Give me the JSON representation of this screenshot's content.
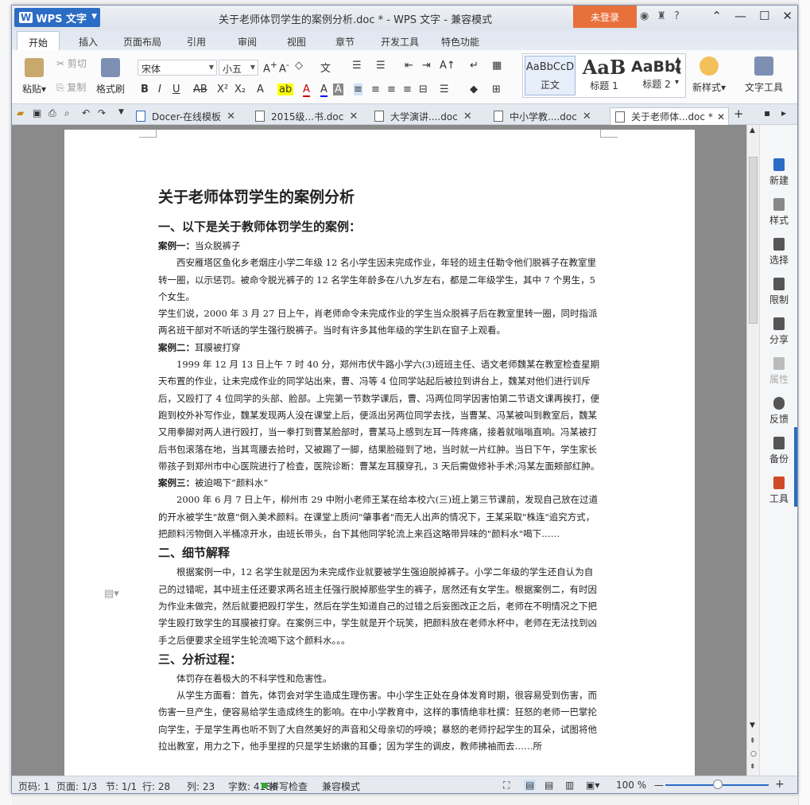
{
  "app": {
    "name": "WPS 文字",
    "window_title": "关于老师体罚学生的案例分析.doc * - WPS 文字 - 兼容模式",
    "login": "未登录"
  },
  "menu": [
    "开始",
    "插入",
    "页面布局",
    "引用",
    "审阅",
    "视图",
    "章节",
    "开发工具",
    "特色功能"
  ],
  "ribbon": {
    "paste": "粘贴",
    "cut": "剪切",
    "copy": "复制",
    "format_painter": "格式刷",
    "font_name": "宋体",
    "font_size": "小五",
    "styles": [
      {
        "preview": "AaBbCcD",
        "name": "正文"
      },
      {
        "preview": "AaB",
        "name": "标题 1"
      },
      {
        "preview": "AaBb(",
        "name": "标题 2"
      }
    ],
    "new_style": "新样式",
    "text_tools": "文字工具"
  },
  "tabs": [
    {
      "label": "Docer-在线模板"
    },
    {
      "label": "2015级...书.doc"
    },
    {
      "label": "大学演讲....doc"
    },
    {
      "label": "中小学教....doc"
    },
    {
      "label": "关于老师体...doc *"
    }
  ],
  "document": {
    "title": "关于老师体罚学生的案例分析",
    "h1_1": "一、以下是关于教师体罚学生的案例：",
    "case1_label": "案例一：",
    "case1_title": "当众脱裤子",
    "case1_p1": "西安雁塔区鱼化乡老烟庄小学二年级 12 名小学生因未完成作业，年轻的班主任勒令他们脱裤子在教室里转一圈，以示惩罚。被命令脱光裤子的 12 名学生年龄多在八九岁左右，都是二年级学生，其中 7 个男生，5 个女生。",
    "case1_p2": "学生们说，2000 年 3 月 27 日上午，肖老师命令未完成作业的学生当众脱裤子后在教室里转一圈，同时指派两名班干部对不听话的学生强行脱裤子。当时有许多其他年级的学生趴在窗子上观看。",
    "case2_label": "案例二：",
    "case2_title": "耳膜被打穿",
    "case2_p1": "1999 年 12 月 13 日上午 7 时 40 分，郑州市伏牛路小学六(3)班班主任、语文老师魏某在教室检查星期天布置的作业，让未完成作业的同学站出来，曹、冯等 4 位同学站起后被拉到讲台上，魏某对他们进行训斥后，又殴打了 4 位同学的头部、脸部。上完第一节数学课后，曹、冯两位同学因害怕第二节语文课再挨打，便跑到校外补写作业，魏某发现两人没在课堂上后，便派出另两位同学去找，当曹某、冯某被叫到教室后，魏某又用拳脚对两人进行殴打，当一拳打到曹某脸部时，曹某马上感到左耳一阵疼痛，接着就嗡嗡直响。冯某被打后书包滚落在地，当其弯腰去拾时，又被踢了一脚，结果脸碰到了地，当时就一片红肿。当日下午，学生家长带孩子到郑州市中心医院进行了检查，医院诊断：曹某左耳膜穿孔，3 天后需做修补手术;冯某左面颊部红肿。",
    "case3_label": "案例三：",
    "case3_title": "被迫喝下“颜料水”",
    "case3_p1": "2000 年 6 月 7 日上午，柳州市 29 中附小老师王某在给本校六(三)班上第三节课前，发现自己放在过道的开水被学生\"故意\"倒入美术颜料。在课堂上质问\"肇事者\"而无人出声的情况下，王某采取\"株连\"追究方式，把颜料污物倒入半桶凉开水，由班长带头，台下其他同学轮流上来舀这略带异味的\"颜料水\"喝下……",
    "h1_2": "二、细节解释",
    "sec2_p1": "根据案例一中，12 名学生就是因为未完成作业就要被学生强迫脱掉裤子。小学二年级的学生还自认为自己的过错呢，其中班主任还要求两名班主任强行脱掉那些学生的裤子，居然还有女学生。根据案例二，有时因为作业未做完，然后就要把殴打学生，然后在学生知道自己的过错之后妄图改正之后，老师在不明情况之下把学生殴打致学生的耳膜被打穿。在案例三中，学生就是开个玩笑，把颜料放在老师水杯中，老师在无法找到凶手之后便要求全班学生轮流喝下这个颜料水。。。",
    "h1_3": "三、分析过程：",
    "sec3_p1": "体罚存在着极大的不科学性和危害性。",
    "sec3_p2": "从学生方面看：首先，体罚会对学生造成生理伤害。中小学生正处在身体发育时期，很容易受到伤害，而伤害一旦产生，便容易给学生造成终生的影响。在中小学教育中，这样的事情绝非杜撰：狂怒的老师一巴掌抡向学生，于是学生再也听不到了大自然美好的声音和父母亲切的呼唤；暴怒的老师拧起学生的耳朵，试图将他拉出教室，用力之下，他手里捏的只是学生娇嫩的耳垂；因为学生的调皮，教师拂袖而去……所"
  },
  "side": [
    "新建",
    "样式",
    "选择",
    "限制",
    "分享",
    "属性",
    "反馈",
    "备份",
    "工具"
  ],
  "status": {
    "page_no": "页码: 1",
    "pages": "页面: 1/3",
    "section": "节: 1/1",
    "row": "行: 28",
    "col": "列: 23",
    "words": "字数: 4186",
    "spell": "拼写检查",
    "compat": "兼容模式",
    "zoom": "100 %"
  },
  "colors": {
    "accent": "#2b6cc4",
    "login": "#e8703a"
  }
}
